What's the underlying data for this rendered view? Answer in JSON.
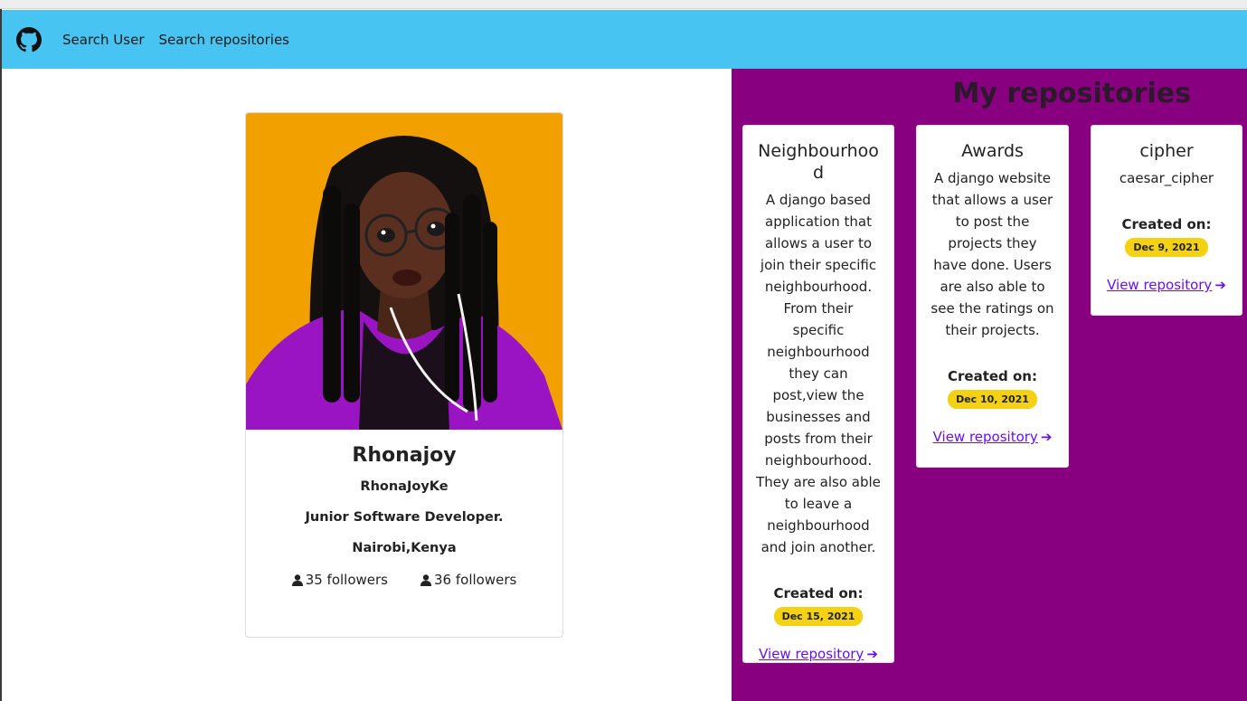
{
  "nav": {
    "logo_icon": "github-icon",
    "links": [
      "Search User",
      "Search repositories"
    ]
  },
  "profile": {
    "name": "Rhonajoy",
    "username": "RhonaJoyKe",
    "bio": "Junior Software Developer.",
    "location": "Nairobi,Kenya",
    "followers": "35 followers",
    "following": "36 followers",
    "stat_icon": "user-icon"
  },
  "repos_title": "My repositories",
  "repos": [
    {
      "name": "Neighbourhood",
      "description": "A django based application that allows a user to join their specific neighbourhood. From their specific neighbourhood they can post,view the businesses and posts from their neighbourhood. They are also able to leave a neighbourhood and join another.",
      "created_label": "Created on:",
      "created_date": "Dec 15, 2021",
      "link_label": "View repository"
    },
    {
      "name": "Awards",
      "description": "A django website that allows a user to post the projects they have done. Users are also able to see the ratings on their projects.",
      "created_label": "Created on:",
      "created_date": "Dec 10, 2021",
      "link_label": "View repository"
    },
    {
      "name": "cipher",
      "description": "caesar_cipher",
      "created_label": "Created on:",
      "created_date": "Dec 9, 2021",
      "link_label": "View repository"
    }
  ],
  "colors": {
    "navbar": "#48c4f2",
    "repo_panel": "#88007f",
    "badge": "#f4d112",
    "link": "#6610f2",
    "avatar_bg": "#f29f00"
  }
}
